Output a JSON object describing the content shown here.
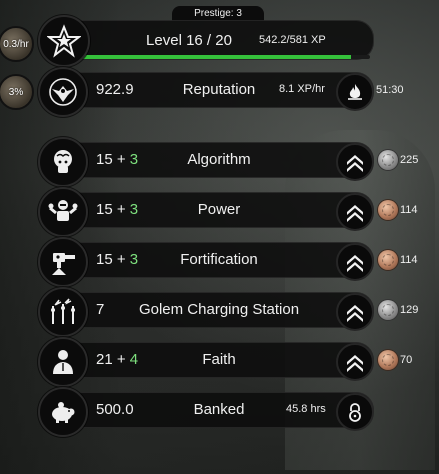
{
  "level": {
    "prestige": "Prestige: 3",
    "label": "Level 16 / 20",
    "xp": "542.2/581 XP",
    "left_chip": "0.3/hr",
    "xp_progress": 0.933
  },
  "reputation": {
    "value": "922.9",
    "name": "Reputation",
    "rate": "8.1 XP/hr",
    "timer": "51:30",
    "left_chip": "3%"
  },
  "stats": [
    {
      "base": "15",
      "plus": " + ",
      "bonus": "3",
      "name": "Algorithm",
      "cost": "225",
      "coin": "silver",
      "icon": "brain-head-icon"
    },
    {
      "base": "15",
      "plus": " + ",
      "bonus": "3",
      "name": "Power",
      "cost": "114",
      "coin": "copper",
      "icon": "flexing-robot-icon"
    },
    {
      "base": "15",
      "plus": " + ",
      "bonus": "3",
      "name": "Fortification",
      "cost": "114",
      "coin": "copper",
      "icon": "turret-icon"
    },
    {
      "base": "7",
      "plus": "",
      "bonus": "",
      "name": "Golem Charging Station",
      "cost": "129",
      "coin": "silver",
      "icon": "charging-coils-icon"
    },
    {
      "base": "21",
      "plus": " + ",
      "bonus": "4",
      "name": "Faith",
      "cost": "70",
      "coin": "copper",
      "icon": "praying-figure-icon"
    }
  ],
  "banked": {
    "value": "500.0",
    "name": "Banked",
    "time": "45.8 hrs"
  },
  "colors": {
    "bonus_green": "#7ee07e",
    "xp_green": "#35c13b",
    "row_bg": "#0c0c0c"
  }
}
